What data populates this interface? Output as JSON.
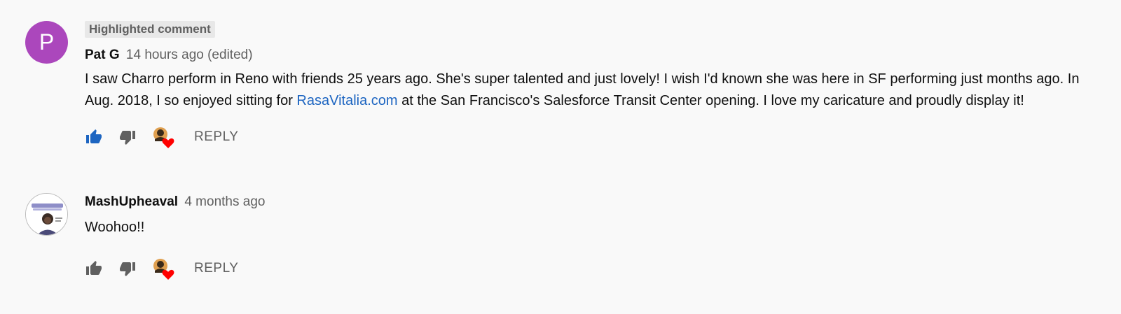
{
  "comments": [
    {
      "avatar_letter": "P",
      "badge": "Highlighted comment",
      "author": "Pat G",
      "timestamp": "14 hours ago (edited)",
      "text_before_link": "I saw Charro perform in Reno with friends 25 years ago. She's super talented and just lovely! I wish I'd known she was here in SF performing just months ago.  In Aug. 2018, I so enjoyed sitting for ",
      "link_text": "RasaVitalia.com",
      "text_after_link": " at the San Francisco's Salesforce Transit Center opening. I love my caricature and proudly display it!",
      "liked": true,
      "reply_label": "REPLY"
    },
    {
      "author": "MashUpheaval",
      "timestamp": "4 months ago",
      "text": "Woohoo!!",
      "liked": false,
      "reply_label": "REPLY"
    }
  ],
  "colors": {
    "avatar_purple": "#ab47bc",
    "link_blue": "#1d65c1",
    "like_active": "#1d65c1",
    "icon_gray": "#606060",
    "heart_red": "#ff0000"
  },
  "icons": {
    "like": "thumb-up-icon",
    "dislike": "thumb-down-icon",
    "creator_heart": "creator-heart-icon"
  }
}
